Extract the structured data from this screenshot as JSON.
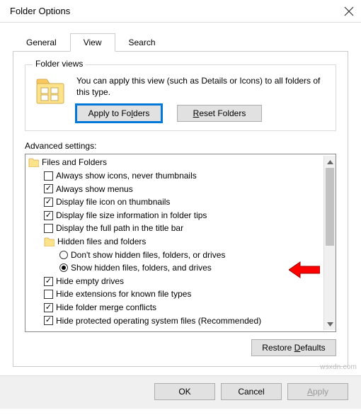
{
  "window": {
    "title": "Folder Options"
  },
  "tabs": {
    "general": "General",
    "view": "View",
    "search": "Search",
    "active": "view"
  },
  "folderViews": {
    "group_title": "Folder views",
    "description": "You can apply this view (such as Details or Icons) to all folders of this type.",
    "apply_button": "Apply to Folders",
    "reset_button": "Reset Folders"
  },
  "advanced": {
    "label": "Advanced settings:",
    "root_label": "Files and Folders",
    "items": [
      {
        "type": "check",
        "checked": false,
        "label": "Always show icons, never thumbnails"
      },
      {
        "type": "check",
        "checked": true,
        "label": "Always show menus"
      },
      {
        "type": "check",
        "checked": true,
        "label": "Display file icon on thumbnails"
      },
      {
        "type": "check",
        "checked": true,
        "label": "Display file size information in folder tips"
      },
      {
        "type": "check",
        "checked": false,
        "label": "Display the full path in the title bar"
      },
      {
        "type": "folder",
        "label": "Hidden files and folders"
      },
      {
        "type": "radio",
        "checked": false,
        "label": "Don't show hidden files, folders, or drives"
      },
      {
        "type": "radio",
        "checked": true,
        "label": "Show hidden files, folders, and drives"
      },
      {
        "type": "check",
        "checked": true,
        "label": "Hide empty drives"
      },
      {
        "type": "check",
        "checked": false,
        "label": "Hide extensions for known file types"
      },
      {
        "type": "check",
        "checked": true,
        "label": "Hide folder merge conflicts"
      },
      {
        "type": "check",
        "checked": true,
        "label": "Hide protected operating system files (Recommended)"
      }
    ]
  },
  "restore_defaults": "Restore Defaults",
  "buttons": {
    "ok": "OK",
    "cancel": "Cancel",
    "apply": "Apply"
  },
  "watermark": "wsxdn.com"
}
